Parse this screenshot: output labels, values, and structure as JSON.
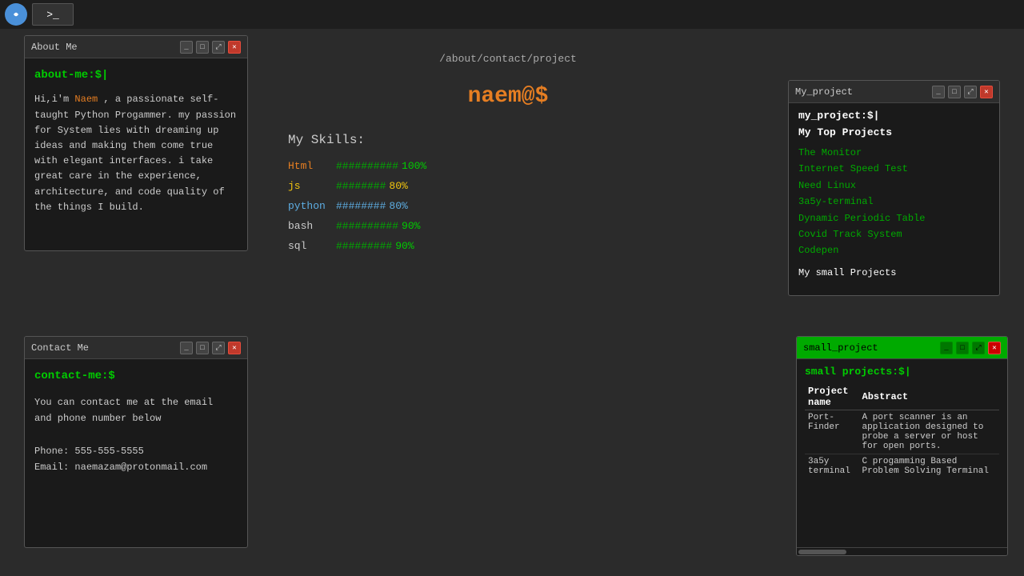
{
  "taskbar": {
    "terminal_label": ">_"
  },
  "about_window": {
    "title": "About Me",
    "prompt": "about-me:$|",
    "intro": "Hi,i'm ",
    "name": "Naem",
    "intro_rest": " , a passionate self-taught Python Progammer. my passion for System lies with dreaming up ideas and making them come true with elegant interfaces. i take great care in the experience, architecture, and code quality of the things I build."
  },
  "contact_window": {
    "title": "Contact Me",
    "prompt": "contact-me:$",
    "line1": "You can contact me at the email",
    "line2": "and phone number below",
    "phone_label": "Phone:",
    "phone": "555-555-5555",
    "email_label": "Email:",
    "email": "naemazam@protonmail.com"
  },
  "main": {
    "nav": "/about/contact/project",
    "logo_text": "naem@$",
    "skills_title": "My Skills:",
    "skills": [
      {
        "name": "Html",
        "bar": "##########",
        "pct": "100%",
        "color": "html"
      },
      {
        "name": "js",
        "bar": "########",
        "pct": "80%",
        "color": "js"
      },
      {
        "name": "python",
        "bar": "########",
        "pct": "80%",
        "color": "python"
      },
      {
        "name": "bash",
        "bar": "##########",
        "pct": "90%",
        "color": "bash"
      },
      {
        "name": "sql",
        "bar": "#########",
        "pct": "90%",
        "color": "sql"
      }
    ]
  },
  "myproject_window": {
    "title": "My_project",
    "prompt": "my_project:$|",
    "heading": "My Top Projects",
    "top_projects": [
      "The Monitor",
      "Internet Speed Test",
      "Need Linux",
      "3a5y-terminal",
      "Dynamic Periodic Table",
      "Covid Track System",
      "Codepen"
    ],
    "small_label": "My small Projects"
  },
  "smallproject_window": {
    "title": "small_project",
    "prompt": "small projects:$|",
    "col1": "Project name",
    "col2": "Abstract",
    "rows": [
      {
        "name": "Port-Finder",
        "abstract": "A port scanner is an application designed to probe a server or host for open ports."
      },
      {
        "name": "3a5y terminal",
        "abstract": "C progamming Based Problem Solving Terminal"
      }
    ]
  }
}
